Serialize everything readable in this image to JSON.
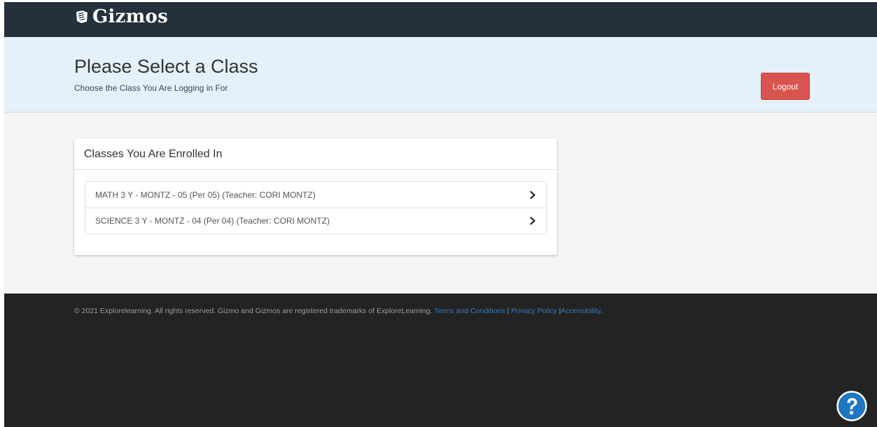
{
  "navbar": {
    "brand_text": "Gizmos",
    "brand_icon": "gizmos-logo-icon"
  },
  "header": {
    "title": "Please Select a Class",
    "subtitle": "Choose the Class You Are Logging in For",
    "logout_label": "Logout"
  },
  "panel": {
    "heading": "Classes You Are Enrolled In",
    "classes": [
      {
        "label": "MATH 3 Y - MONTZ - 05 (Per 05) (Teacher: CORI MONTZ)",
        "icon": "chevron-right-icon"
      },
      {
        "label": "SCIENCE 3 Y - MONTZ - 04 (Per 04) (Teacher: CORI MONTZ)",
        "icon": "chevron-right-icon"
      }
    ]
  },
  "footer": {
    "copyright": "© 2021 Explorelearning.  All rights reserved.  Gizmo and Gizmos are registered trademarks of ExploreLearning.",
    "terms_link": "Terms and Conditions",
    "sep1": "|",
    "privacy_link": "Privacy Policy",
    "sep2": "|",
    "accessibility_link": "Accessibility",
    "end": "."
  },
  "help": {
    "icon": "help-question-icon"
  },
  "colors": {
    "navbar_bg": "#24303b",
    "hero_bg": "#e4f1fb",
    "logout_bg": "#d9534f",
    "footer_bg": "#232323",
    "link": "#3a78b5",
    "help_blue": "#1f76c2"
  }
}
